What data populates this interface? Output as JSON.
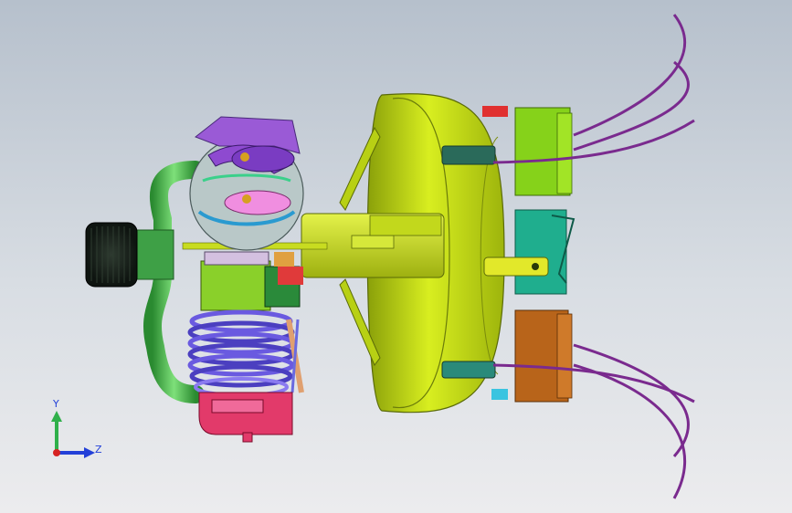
{
  "viewport": {
    "background_top": "#b6c0cc",
    "background_bottom": "#ececee"
  },
  "triad": {
    "y_label": "Y",
    "z_label": "Z",
    "y_color": "#2fb04a",
    "z_color": "#2340d8",
    "x_color": "#d62222"
  },
  "model": {
    "housing_color": "#c4dc10",
    "cylinder_color": "#4b3fc0",
    "cylinder_head_color": "#e23a6a",
    "crank_cover_color": "#9a5ad6",
    "pipe_color": "#48b84a",
    "box_top_color": "#86d21a",
    "box_mid_color": "#1fae8e",
    "box_bottom_color": "#b8641a",
    "cable_color": "#7a2a8e"
  }
}
